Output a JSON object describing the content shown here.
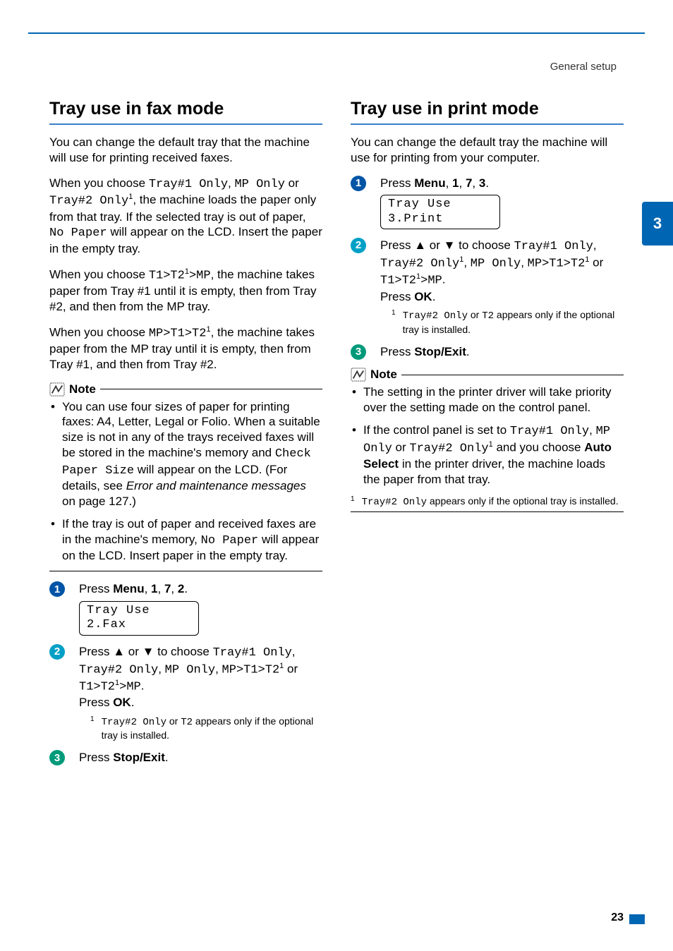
{
  "header": {
    "section": "General setup"
  },
  "tab": {
    "number": "3"
  },
  "left": {
    "title": "Tray use in fax mode",
    "p1": "You can change the default tray that the machine will use for printing received faxes.",
    "p2a": "When you choose ",
    "p2_opt1": "Tray#1 Only",
    "p2_comma1": ", ",
    "p2_opt2": "MP Only",
    "p2_or": " or ",
    "p2_opt3": "Tray#2 Only",
    "p2_sup": "1",
    "p2b": ", the machine loads the paper only from that tray. If the selected tray is out of paper, ",
    "p2_code": "No Paper",
    "p2c": " will appear on the LCD. Insert the paper in the empty tray.",
    "p3a": "When you choose ",
    "p3_code1": "T1>T2",
    "p3_sup1": "1",
    "p3_code2": ">MP",
    "p3b": ", the machine takes paper from Tray #1 until it is empty, then from Tray #2, and then from the MP tray.",
    "p4a": "When you choose ",
    "p4_code": "MP>T1>T2",
    "p4_sup": "1",
    "p4b": ", the machine takes paper from the MP tray until it is empty, then from Tray #1, and then from Tray #2.",
    "note_label": "Note",
    "note1a": "You can use four sizes of paper for printing faxes: A4, Letter, Legal or Folio. When a suitable size is not in any of the trays received faxes will be stored in the machine's memory and ",
    "note1_code": "Check Paper Size",
    "note1b": " will appear on the LCD. (For details, see ",
    "note1_i": "Error and maintenance messages",
    "note1c": " on page 127.)",
    "note2a": "If the tray is out of paper and received faxes are in the machine's memory, ",
    "note2_code": "No Paper",
    "note2b": " will appear on the LCD. Insert paper in the empty tray.",
    "step1_a": "Press ",
    "step1_b1": "Menu",
    "step1_c1": ", ",
    "step1_b2": "1",
    "step1_c2": ", ",
    "step1_b3": "7",
    "step1_c3": ", ",
    "step1_b4": "2",
    "step1_end": ".",
    "lcd1": "Tray Use",
    "lcd2": "2.Fax",
    "step2_a": "Press ",
    "step2_up": "▲",
    "step2_or1": " or ",
    "step2_dn": "▼",
    "step2_b": " to choose ",
    "step2_opt1": "Tray#1 Only",
    "step2_comma1": ", ",
    "step2_opt2": "Tray#2 Only",
    "step2_comma2": ", ",
    "step2_opt3": "MP Only",
    "step2_comma3": ", ",
    "step2_opt4": "MP>T1>T2",
    "step2_sup1": "1",
    "step2_or2": " or ",
    "step2_opt5a": "T1>T2",
    "step2_sup2": "1",
    "step2_opt5b": ">MP",
    "step2_end": ".",
    "step2_press": "Press ",
    "step2_ok": "OK",
    "fn_mark": "1",
    "fn_a": "",
    "fn_code1": "Tray#2 Only",
    "fn_or": " or ",
    "fn_code2": "T2",
    "fn_b": " appears only if the optional tray is installed.",
    "step3_a": "Press ",
    "step3_b": "Stop/Exit",
    "step3_end": "."
  },
  "right": {
    "title": "Tray use in print mode",
    "p1": "You can change the default tray the machine will use for printing from your computer.",
    "step1_a": "Press ",
    "step1_b1": "Menu",
    "step1_c1": ", ",
    "step1_b2": "1",
    "step1_c2": ", ",
    "step1_b3": "7",
    "step1_c3": ", ",
    "step1_b4": "3",
    "step1_end": ".",
    "lcd1": "Tray Use",
    "lcd2": "3.Print",
    "step2_a": "Press ",
    "step2_up": "▲",
    "step2_or1": " or ",
    "step2_dn": "▼",
    "step2_b": " to choose ",
    "step2_opt1": "Tray#1 Only",
    "step2_comma1": ", ",
    "step2_opt2": "Tray#2 Only",
    "step2_sup1": "1",
    "step2_comma2": ", ",
    "step2_opt3": "MP Only",
    "step2_comma3": ", ",
    "step2_opt4a": "MP>T1>T2",
    "step2_sup2": "1",
    "step2_or2": " or ",
    "step2_opt5a": "T1>T2",
    "step2_sup3": "1",
    "step2_opt5b": ">MP",
    "step2_end": ".",
    "step2_press": "Press ",
    "step2_ok": "OK",
    "fn_mark": "1",
    "fn_code1": "Tray#2 Only",
    "fn_or": " or ",
    "fn_code2": "T2",
    "fn_b": " appears only if the optional tray is installed.",
    "step3_a": "Press ",
    "step3_b": "Stop/Exit",
    "step3_end": ".",
    "note_label": "Note",
    "note1": "The setting in the printer driver will take priority over the setting made on the control panel.",
    "note2a": "If the control panel is set to ",
    "note2_c1": "Tray#1 Only",
    "note2_c1b": ", ",
    "note2_c2": "MP Only",
    "note2_or": " or ",
    "note2_c3": "Tray#2 Only",
    "note2_sup": "1",
    "note2b": " and you choose ",
    "note2_bold": "Auto Select",
    "note2c": " in the printer driver, the machine loads the paper from that tray.",
    "fn2_mark": "1",
    "fn2_code": "Tray#2 Only",
    "fn2_b": " appears only if the optional tray is installed."
  },
  "page": {
    "number": "23"
  }
}
